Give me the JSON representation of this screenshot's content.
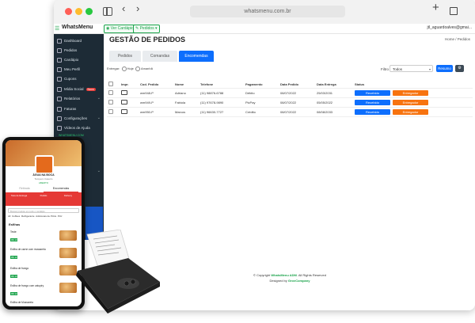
{
  "browser": {
    "url": "whatsmenu.com.br"
  },
  "app": {
    "brand": "WhatsMenu",
    "pills": [
      "Ver Cardápio",
      "Pedidos"
    ],
    "user": "jtl_aguardoalves@gmai..."
  },
  "sidebar": {
    "items": [
      {
        "label": "Dashboard"
      },
      {
        "label": "Pedidos"
      },
      {
        "label": "Cardápio"
      },
      {
        "label": "Meu Perfil"
      },
      {
        "label": "Cupons"
      },
      {
        "label": "Mídia Social",
        "badge": "Novo"
      },
      {
        "label": "Relatórios"
      },
      {
        "label": "Faturas"
      },
      {
        "label": "Configurações"
      },
      {
        "label": "Vídeos de Ajuda"
      }
    ],
    "link": "WHATSMENU.COM"
  },
  "page": {
    "title": "GESTÃO DE PEDIDOS",
    "breadcrumb": "Home  /  Pedidos",
    "tabs": [
      "Pedidos",
      "Comandas",
      "Encomendas"
    ],
    "active_tab": "Encomendas",
    "filter_label": "Entregar:",
    "filter_options": [
      "Hoje",
      "Amanhã"
    ],
    "filtro_label": "Filtro",
    "filtro_value": "Todos",
    "resumo_button": "Resumo",
    "gear": "⚙"
  },
  "table": {
    "headers": [
      "",
      "Impr.",
      "Cod. Pedido",
      "Nome",
      "Telefone",
      "Pagamento",
      "Data Pedido",
      "Data Entrega",
      "Status"
    ],
    "rows": [
      {
        "code": "wm948-P",
        "name": "Adriano",
        "phone": "(11) 98876-6788",
        "payment": "Débito",
        "order_date": "08/07/2022",
        "delivery_date": "25/03/2031"
      },
      {
        "code": "wm949-P",
        "name": "Fabiola",
        "phone": "(11) 97678-9890",
        "payment": "PicPay",
        "order_date": "08/07/2022",
        "delivery_date": "05/05/2022"
      },
      {
        "code": "wm950-P",
        "name": "Marcos",
        "phone": "(11) 96630-7727",
        "payment": "Crédito",
        "order_date": "08/07/2022",
        "delivery_date": "08/08/2033"
      }
    ],
    "btn_received": "Recebido",
    "btn_delivery": "Entregador"
  },
  "footer": {
    "line1_pre": "© Copyright ",
    "line1_brand": "WhatsMenu ADM",
    "line1_post": ". All Rights Reserved",
    "line2_pre": "Designed by ",
    "line2_brand": "GrovCompany"
  },
  "phone": {
    "store": "ÁGUA NA BOCA",
    "subtitle": "Tempero Caseiro",
    "status": "ABERTO",
    "tabs": [
      "Retirada",
      "Encomendas"
    ],
    "red_items": [
      "Taxa de Entrega",
      "Pedido",
      "Delivery"
    ],
    "search": "Buscar produto em todo o cardápio",
    "cats": [
      "All",
      "Coffees",
      "Refrigerante",
      "Adicionais de Pizza",
      "Pizz"
    ],
    "section": "Esfihas",
    "items": [
      {
        "name": "Teste",
        "price": "R$ 10"
      },
      {
        "name": "Esfiha de carne com mussarela",
        "price": "R$ 12"
      },
      {
        "name": "Esfiha de frango",
        "price": "R$ 10"
      },
      {
        "name": "Esfiha de frango com catupiry",
        "price": "R$ 12"
      },
      {
        "name": "Esfiha de Mussarela",
        "price": ""
      }
    ]
  }
}
